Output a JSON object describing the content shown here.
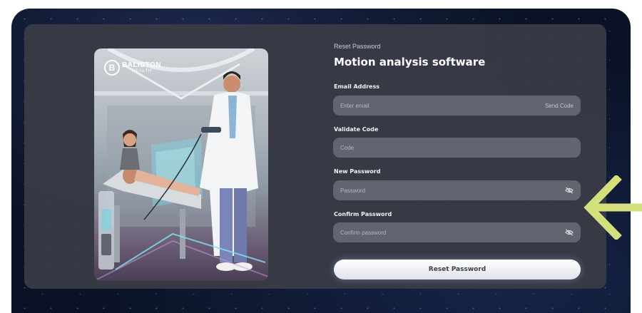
{
  "brand": {
    "logo_letter": "B",
    "logo_name": "BALISTON",
    "logo_sub": "HEALTH"
  },
  "form": {
    "breadcrumb": "Reset Password",
    "title": "Motion analysis software",
    "email": {
      "label": "Email Address",
      "placeholder": "Enter email",
      "action": "Send Code"
    },
    "code": {
      "label": "Validate Code",
      "placeholder": "Code"
    },
    "new_password": {
      "label": "New Password",
      "placeholder": "Password"
    },
    "confirm_password": {
      "label": "Confirm Password",
      "placeholder": "Confirm password"
    },
    "submit_label": "Reset Password"
  },
  "icons": {
    "password_visibility": "eye-slash-icon",
    "annotation_arrow": "arrow-left-icon"
  },
  "colors": {
    "background": "#0b1226",
    "panel": "#3a3c46",
    "field": "#62656f",
    "arrow": "#d3e07c"
  }
}
